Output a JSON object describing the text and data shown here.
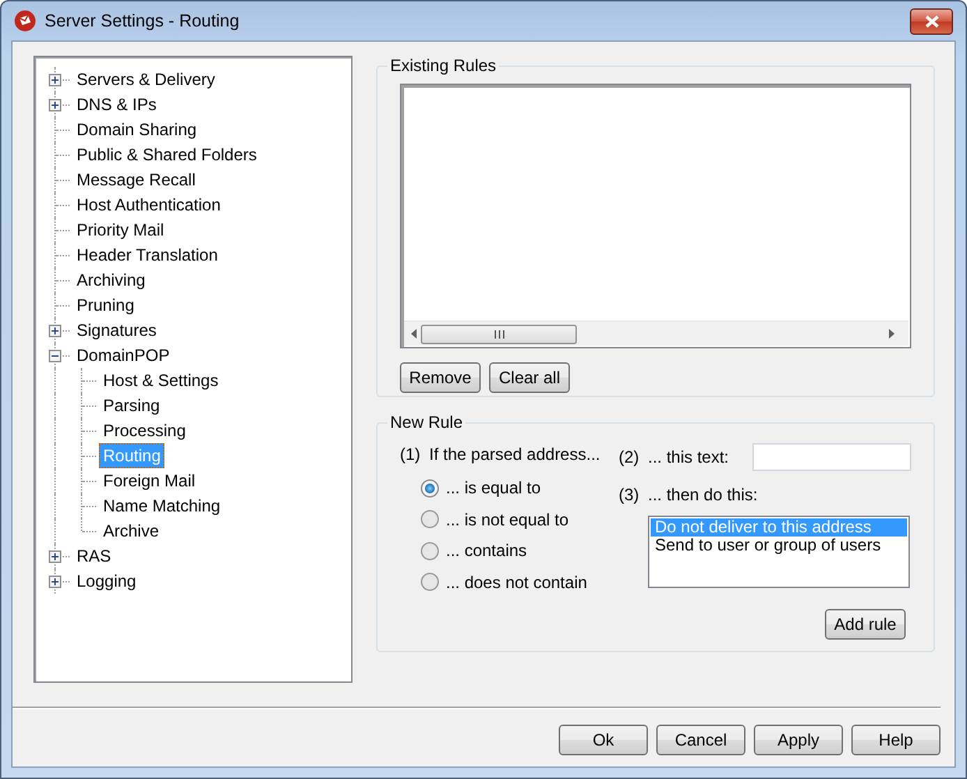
{
  "window": {
    "title": "Server Settings - Routing"
  },
  "tree": [
    {
      "label": "Servers & Delivery",
      "expanded": false,
      "selected": false
    },
    {
      "label": "DNS & IPs",
      "expanded": false,
      "selected": false
    },
    {
      "label": "Domain Sharing",
      "selected": false
    },
    {
      "label": "Public & Shared Folders",
      "selected": false
    },
    {
      "label": "Message Recall",
      "selected": false
    },
    {
      "label": "Host Authentication",
      "selected": false
    },
    {
      "label": "Priority Mail",
      "selected": false
    },
    {
      "label": "Header Translation",
      "selected": false
    },
    {
      "label": "Archiving",
      "selected": false
    },
    {
      "label": "Pruning",
      "selected": false
    },
    {
      "label": "Signatures",
      "expanded": false,
      "selected": false
    },
    {
      "label": "DomainPOP",
      "expanded": true,
      "selected": false,
      "children": [
        {
          "label": "Host & Settings",
          "selected": false
        },
        {
          "label": "Parsing",
          "selected": false
        },
        {
          "label": "Processing",
          "selected": false
        },
        {
          "label": "Routing",
          "selected": true
        },
        {
          "label": "Foreign Mail",
          "selected": false
        },
        {
          "label": "Name Matching",
          "selected": false
        },
        {
          "label": "Archive",
          "selected": false
        }
      ]
    },
    {
      "label": "RAS",
      "expanded": false,
      "selected": false
    },
    {
      "label": "Logging",
      "expanded": false,
      "selected": false
    }
  ],
  "existing_rules": {
    "title": "Existing Rules",
    "buttons": [
      "Remove",
      "Clear all"
    ]
  },
  "new_rule": {
    "title": "New Rule",
    "condition": {
      "number": "(1)",
      "label": "If the parsed address...",
      "options": [
        {
          "label": "... is equal to",
          "selected": true
        },
        {
          "label": "... is not equal to",
          "selected": false
        },
        {
          "label": "... contains",
          "selected": false
        },
        {
          "label": "... does not contain",
          "selected": false
        }
      ]
    },
    "text": {
      "number": "(2)",
      "label": "... this text:"
    },
    "action": {
      "number": "(3)",
      "label": "... then do this:",
      "options": [
        {
          "label": "Do not deliver to this address",
          "selected": true
        },
        {
          "label": "Send to user or group of users",
          "selected": false
        }
      ]
    },
    "add_button": "Add rule"
  },
  "buttons": [
    "Ok",
    "Cancel",
    "Apply",
    "Help"
  ]
}
